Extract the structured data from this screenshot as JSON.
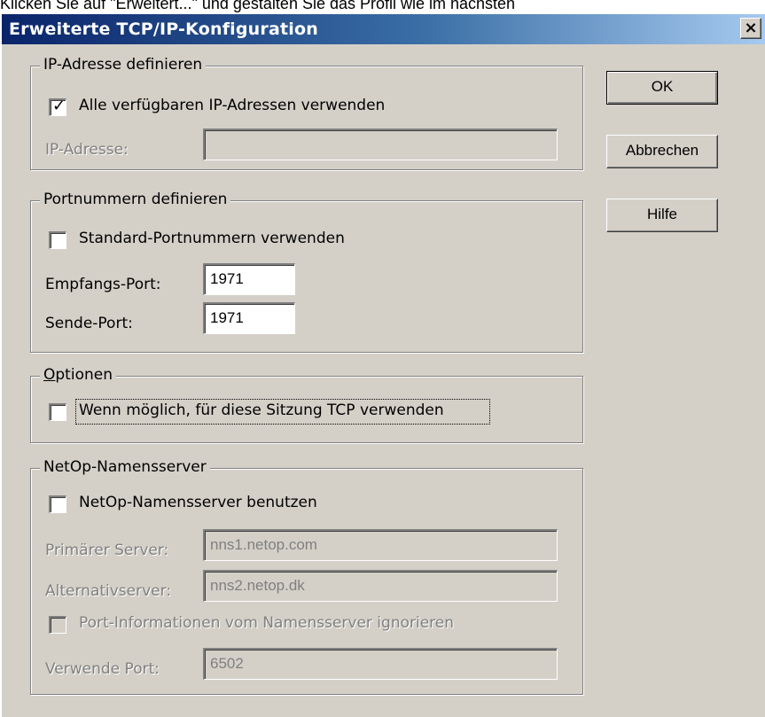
{
  "caption": "Klicken Sie auf \"Erweitert...\" und gestalten Sie das Profil wie im nächsten",
  "window": {
    "title": "Erweiterte TCP/IP-Konfiguration",
    "close_label": "×"
  },
  "buttons": {
    "ok": "OK",
    "cancel": "Abbrechen",
    "help": "Hilfe"
  },
  "ip_group": {
    "legend": "IP-Adresse definieren",
    "use_all_label": "Alle verfügbaren IP-Adressen verwenden",
    "use_all_checked": true,
    "ip_label": "IP-Adresse:",
    "ip_value": ""
  },
  "port_group": {
    "legend": "Portnummern definieren",
    "standard_label": "Standard-Portnummern verwenden",
    "standard_checked": false,
    "receive_label": "Empfangs-Port:",
    "receive_value": "1971",
    "send_label": "Sende-Port:",
    "send_value": "1971"
  },
  "options_group": {
    "legend_first": "O",
    "legend_rest": "ptionen",
    "tcp_label": "Wenn möglich, für diese Sitzung TCP verwenden",
    "tcp_checked": false
  },
  "nameserver_group": {
    "legend": "NetOp-Namensserver",
    "use_label": "NetOp-Namensserver benutzen",
    "use_checked": false,
    "primary_label": "Primärer Server:",
    "primary_value": "nns1.netop.com",
    "alt_label": "Alternativserver:",
    "alt_value": "nns2.netop.dk",
    "ignore_label": "Port-Informationen vom Namensserver ignorieren",
    "ignore_checked": false,
    "port_label": "Verwende Port:",
    "port_value": "6502"
  },
  "colors": {
    "dialog_bg": "#d4d0c8",
    "title_start": "#0a246a",
    "title_end": "#a6caf0",
    "disabled_text": "#808080"
  }
}
